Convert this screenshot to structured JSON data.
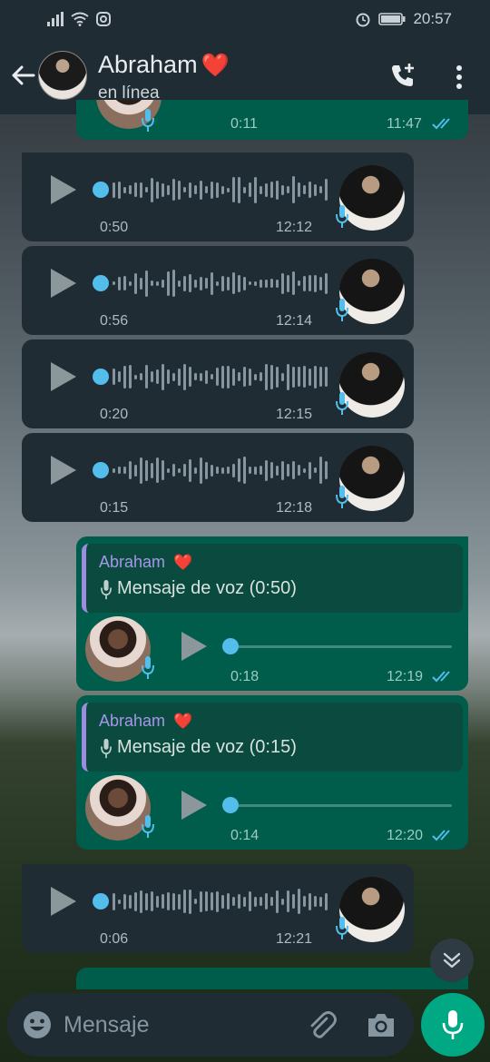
{
  "status_bar": {
    "time": "20:57"
  },
  "header": {
    "contact_name": "Abraham",
    "heart": "❤️",
    "presence": "en línea",
    "icons": [
      "back-arrow-icon",
      "avatar",
      "call-add-icon",
      "more-vert-icon"
    ]
  },
  "messages": [
    {
      "dir": "out",
      "duration": "0:11",
      "time": "11:47",
      "progress": 0,
      "read": true,
      "partial": true
    },
    {
      "dir": "in",
      "duration": "0:50",
      "time": "12:12",
      "progress": 0
    },
    {
      "dir": "in",
      "duration": "0:56",
      "time": "12:14",
      "progress": 0
    },
    {
      "dir": "in",
      "duration": "0:20",
      "time": "12:15",
      "progress": 0
    },
    {
      "dir": "in",
      "duration": "0:15",
      "time": "12:18",
      "progress": 0
    },
    {
      "dir": "out",
      "reply_name": "Abraham",
      "reply_text": "Mensaje de voz (0:50)",
      "duration": "0:18",
      "time": "12:19",
      "progress": 0,
      "read": true
    },
    {
      "dir": "out",
      "reply_name": "Abraham",
      "reply_text": "Mensaje de voz (0:15)",
      "duration": "0:14",
      "time": "12:20",
      "progress": 0,
      "read": true
    },
    {
      "dir": "in",
      "duration": "0:06",
      "time": "12:21",
      "progress": 0
    }
  ],
  "composer": {
    "placeholder": "Mensaje"
  },
  "colors": {
    "accent": "#00a884",
    "incoming": "#202c33",
    "outgoing": "#005c4b",
    "played_dot": "#53bdeb",
    "read_ticks": "#53bdeb"
  }
}
